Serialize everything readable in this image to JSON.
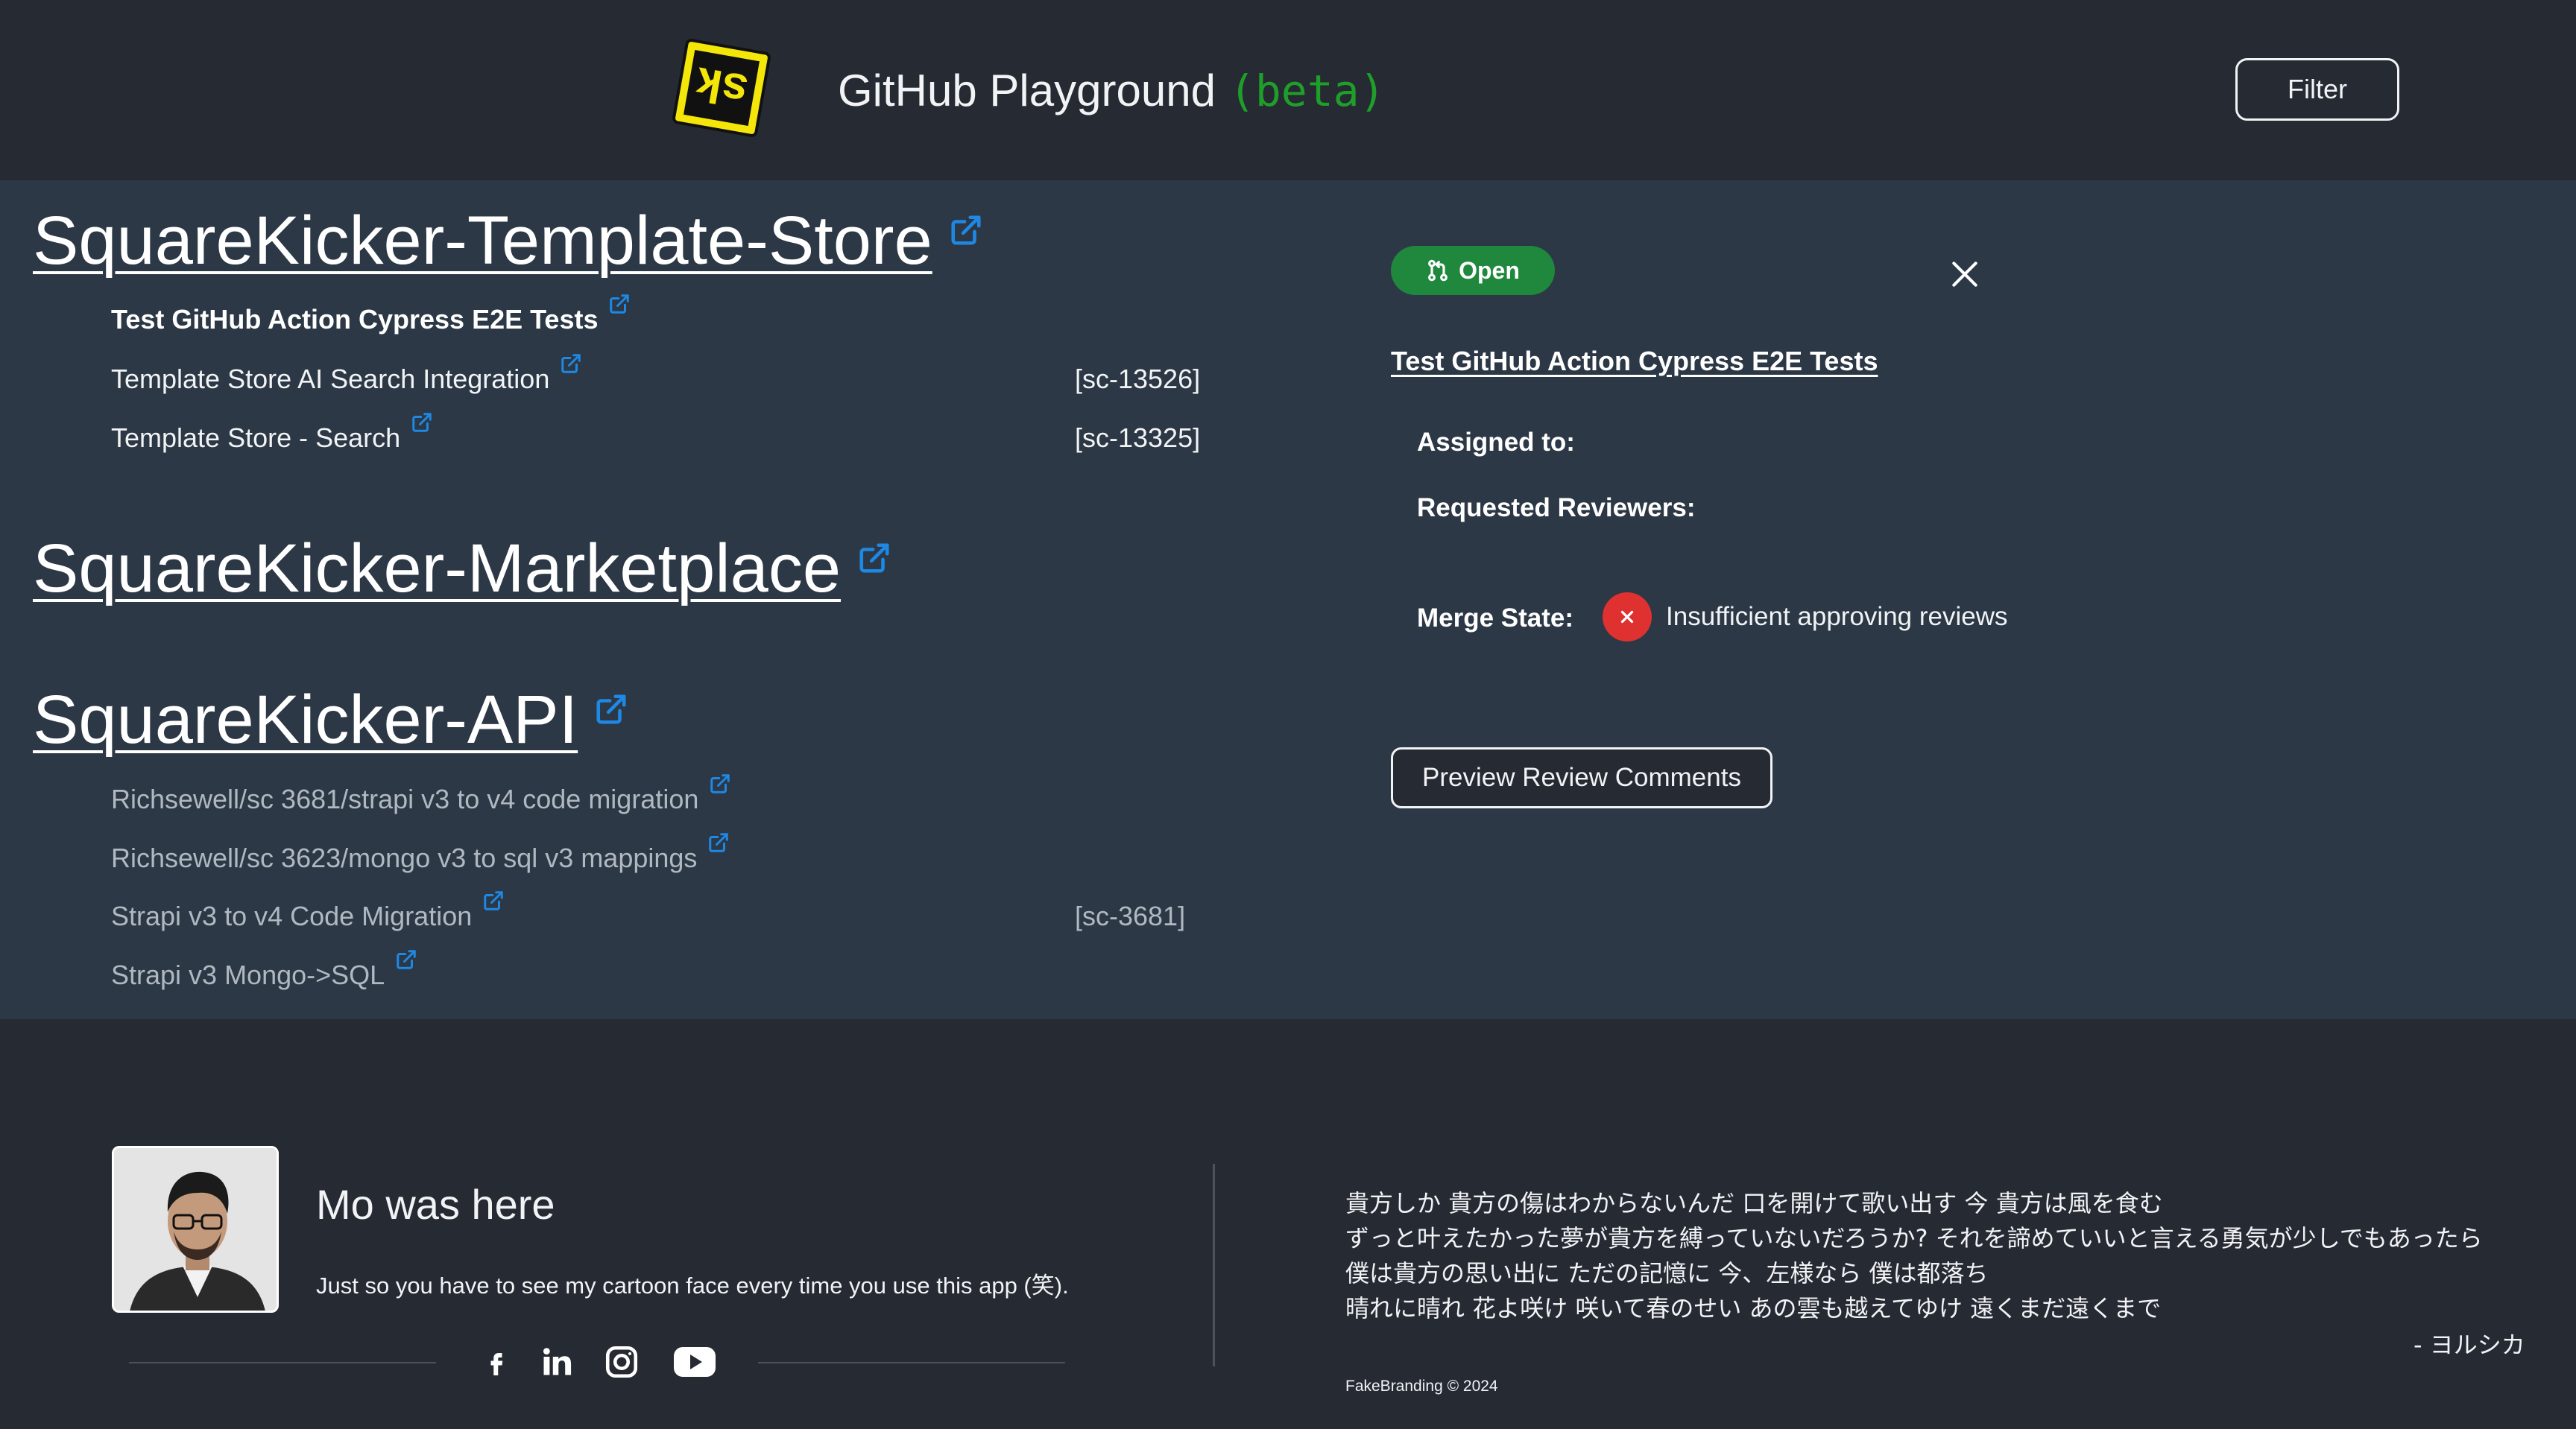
{
  "header": {
    "logo_text": "sk",
    "app_title": "GitHub Playground",
    "beta_label": "(beta)",
    "filter_label": "Filter"
  },
  "repos": [
    {
      "name": "SquareKicker-Template-Store",
      "prs": [
        {
          "title": "Test GitHub Action Cypress E2E Tests",
          "ticket": "",
          "style": "selected"
        },
        {
          "title": "Template Store AI Search Integration",
          "ticket": "[sc-13526]",
          "style": "normal"
        },
        {
          "title": "Template Store - Search",
          "ticket": "[sc-13325]",
          "style": "normal"
        }
      ]
    },
    {
      "name": "SquareKicker-Marketplace",
      "prs": []
    },
    {
      "name": "SquareKicker-API",
      "prs": [
        {
          "title": "Richsewell/sc 3681/strapi v3 to v4 code migration",
          "ticket": "",
          "style": "muted"
        },
        {
          "title": "Richsewell/sc 3623/mongo v3 to sql v3 mappings",
          "ticket": "",
          "style": "muted"
        },
        {
          "title": "Strapi v3 to v4 Code Migration",
          "ticket": "[sc-3681]",
          "style": "muted"
        },
        {
          "title": "Strapi v3 Mongo->SQL",
          "ticket": "",
          "style": "muted"
        }
      ]
    }
  ],
  "detail": {
    "status": "Open",
    "status_color": "#1f883d",
    "title": "Test GitHub Action Cypress E2E Tests",
    "assigned_label": "Assigned to:",
    "reviewers_label": "Requested Reviewers:",
    "merge_label": "Merge State:",
    "merge_state": "Insufficient approving reviews",
    "merge_state_color": "#e03131",
    "preview_button": "Preview Review Comments"
  },
  "footer": {
    "title": "Mo was here",
    "subtitle": "Just so you have to see my cartoon face every time you use this app (笑).",
    "socials": [
      "facebook-icon",
      "linkedin-icon",
      "instagram-icon",
      "youtube-icon"
    ],
    "lyrics": [
      "貴方しか 貴方の傷はわからないんだ 口を開けて歌い出す 今 貴方は風を食む",
      "ずっと叶えたかった夢が貴方を縛っていないだろうか? それを諦めていいと言える勇気が少しでもあったら",
      "僕は貴方の思い出に ただの記憶に 今、左様なら 僕は都落ち",
      "晴れに晴れ 花よ咲け 咲いて春のせい あの雲も越えてゆけ 遠くまだ遠くまで"
    ],
    "lyric_author": "- ヨルシカ",
    "copyright": "FakeBranding © 2024"
  },
  "colors": {
    "accent_link": "#1e88e5",
    "beta": "#1f9e2a",
    "logo_yellow": "#f5e60a"
  }
}
